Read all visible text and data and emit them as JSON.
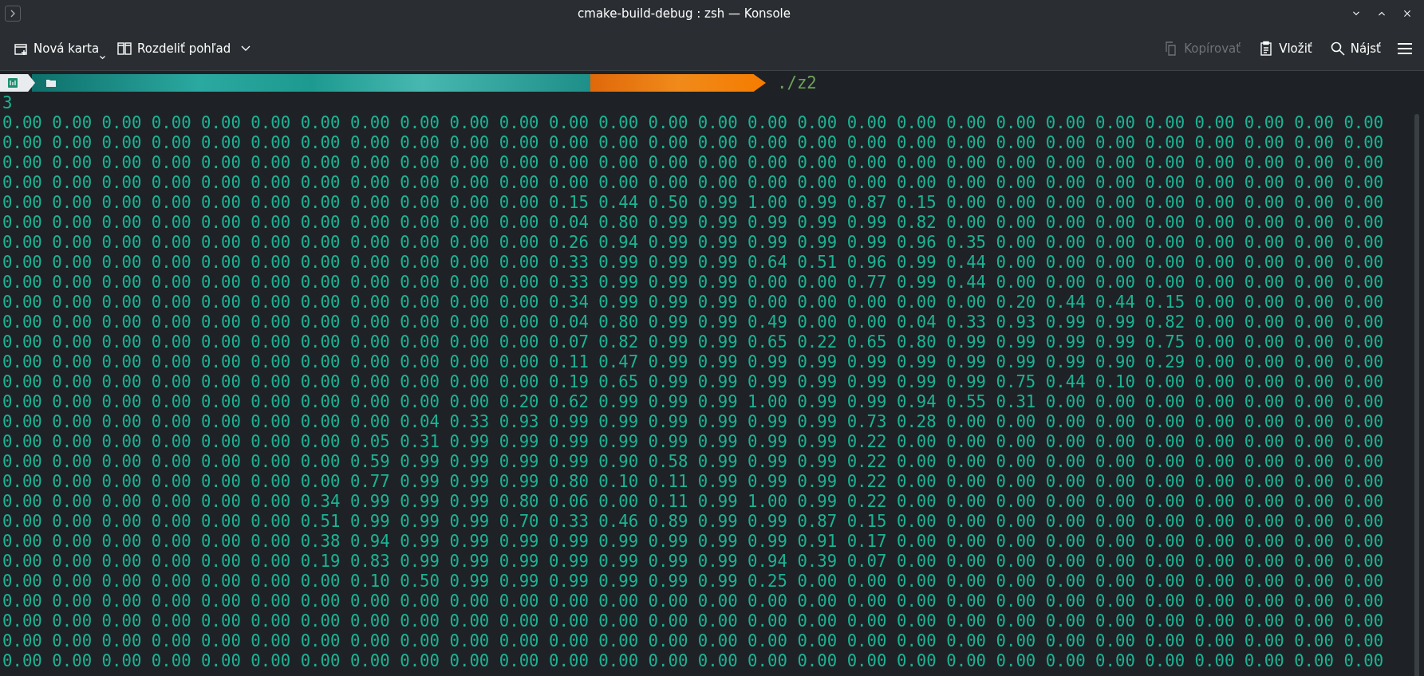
{
  "window": {
    "title": "cmake-build-debug : zsh — Konsole"
  },
  "toolbar": {
    "left": [
      {
        "label": "Nová karta",
        "kind": "menu"
      },
      {
        "label": "Rozdeliť pohľad",
        "kind": "dropdown"
      }
    ],
    "right": [
      {
        "label": "Kopírovať",
        "disabled": true
      },
      {
        "label": "Vložiť",
        "disabled": false
      },
      {
        "label": "Nájsť",
        "disabled": false
      }
    ]
  },
  "prompt": {
    "command": "./z2"
  },
  "output": {
    "lines": [
      "3",
      "0.00 0.00 0.00 0.00 0.00 0.00 0.00 0.00 0.00 0.00 0.00 0.00 0.00 0.00 0.00 0.00 0.00 0.00 0.00 0.00 0.00 0.00 0.00 0.00 0.00 0.00 0.00 0.00",
      "0.00 0.00 0.00 0.00 0.00 0.00 0.00 0.00 0.00 0.00 0.00 0.00 0.00 0.00 0.00 0.00 0.00 0.00 0.00 0.00 0.00 0.00 0.00 0.00 0.00 0.00 0.00 0.00",
      "0.00 0.00 0.00 0.00 0.00 0.00 0.00 0.00 0.00 0.00 0.00 0.00 0.00 0.00 0.00 0.00 0.00 0.00 0.00 0.00 0.00 0.00 0.00 0.00 0.00 0.00 0.00 0.00",
      "0.00 0.00 0.00 0.00 0.00 0.00 0.00 0.00 0.00 0.00 0.00 0.00 0.00 0.00 0.00 0.00 0.00 0.00 0.00 0.00 0.00 0.00 0.00 0.00 0.00 0.00 0.00 0.00",
      "0.00 0.00 0.00 0.00 0.00 0.00 0.00 0.00 0.00 0.00 0.00 0.15 0.44 0.50 0.99 1.00 0.99 0.87 0.15 0.00 0.00 0.00 0.00 0.00 0.00 0.00 0.00 0.00",
      "0.00 0.00 0.00 0.00 0.00 0.00 0.00 0.00 0.00 0.00 0.00 0.04 0.80 0.99 0.99 0.99 0.99 0.99 0.82 0.00 0.00 0.00 0.00 0.00 0.00 0.00 0.00 0.00",
      "0.00 0.00 0.00 0.00 0.00 0.00 0.00 0.00 0.00 0.00 0.00 0.26 0.94 0.99 0.99 0.99 0.99 0.99 0.96 0.35 0.00 0.00 0.00 0.00 0.00 0.00 0.00 0.00",
      "0.00 0.00 0.00 0.00 0.00 0.00 0.00 0.00 0.00 0.00 0.00 0.33 0.99 0.99 0.99 0.64 0.51 0.96 0.99 0.44 0.00 0.00 0.00 0.00 0.00 0.00 0.00 0.00",
      "0.00 0.00 0.00 0.00 0.00 0.00 0.00 0.00 0.00 0.00 0.00 0.33 0.99 0.99 0.99 0.00 0.00 0.77 0.99 0.44 0.00 0.00 0.00 0.00 0.00 0.00 0.00 0.00",
      "0.00 0.00 0.00 0.00 0.00 0.00 0.00 0.00 0.00 0.00 0.00 0.34 0.99 0.99 0.99 0.00 0.00 0.00 0.00 0.00 0.20 0.44 0.44 0.15 0.00 0.00 0.00 0.00",
      "0.00 0.00 0.00 0.00 0.00 0.00 0.00 0.00 0.00 0.00 0.00 0.04 0.80 0.99 0.99 0.49 0.00 0.00 0.04 0.33 0.93 0.99 0.99 0.82 0.00 0.00 0.00 0.00",
      "0.00 0.00 0.00 0.00 0.00 0.00 0.00 0.00 0.00 0.00 0.00 0.07 0.82 0.99 0.99 0.65 0.22 0.65 0.80 0.99 0.99 0.99 0.99 0.75 0.00 0.00 0.00 0.00",
      "0.00 0.00 0.00 0.00 0.00 0.00 0.00 0.00 0.00 0.00 0.00 0.11 0.47 0.99 0.99 0.99 0.99 0.99 0.99 0.99 0.99 0.99 0.90 0.29 0.00 0.00 0.00 0.00",
      "0.00 0.00 0.00 0.00 0.00 0.00 0.00 0.00 0.00 0.00 0.00 0.19 0.65 0.99 0.99 0.99 0.99 0.99 0.99 0.99 0.75 0.44 0.10 0.00 0.00 0.00 0.00 0.00",
      "0.00 0.00 0.00 0.00 0.00 0.00 0.00 0.00 0.00 0.00 0.20 0.62 0.99 0.99 0.99 1.00 0.99 0.99 0.94 0.55 0.31 0.00 0.00 0.00 0.00 0.00 0.00 0.00",
      "0.00 0.00 0.00 0.00 0.00 0.00 0.00 0.00 0.04 0.33 0.93 0.99 0.99 0.99 0.99 0.99 0.99 0.73 0.28 0.00 0.00 0.00 0.00 0.00 0.00 0.00 0.00 0.00",
      "0.00 0.00 0.00 0.00 0.00 0.00 0.00 0.05 0.31 0.99 0.99 0.99 0.99 0.99 0.99 0.99 0.99 0.22 0.00 0.00 0.00 0.00 0.00 0.00 0.00 0.00 0.00 0.00",
      "0.00 0.00 0.00 0.00 0.00 0.00 0.00 0.59 0.99 0.99 0.99 0.99 0.90 0.58 0.99 0.99 0.99 0.22 0.00 0.00 0.00 0.00 0.00 0.00 0.00 0.00 0.00 0.00",
      "0.00 0.00 0.00 0.00 0.00 0.00 0.00 0.77 0.99 0.99 0.99 0.80 0.10 0.11 0.99 0.99 0.99 0.22 0.00 0.00 0.00 0.00 0.00 0.00 0.00 0.00 0.00 0.00",
      "0.00 0.00 0.00 0.00 0.00 0.00 0.34 0.99 0.99 0.99 0.80 0.06 0.00 0.11 0.99 1.00 0.99 0.22 0.00 0.00 0.00 0.00 0.00 0.00 0.00 0.00 0.00 0.00",
      "0.00 0.00 0.00 0.00 0.00 0.00 0.51 0.99 0.99 0.99 0.70 0.33 0.46 0.89 0.99 0.99 0.87 0.15 0.00 0.00 0.00 0.00 0.00 0.00 0.00 0.00 0.00 0.00",
      "0.00 0.00 0.00 0.00 0.00 0.00 0.38 0.94 0.99 0.99 0.99 0.99 0.99 0.99 0.99 0.99 0.91 0.17 0.00 0.00 0.00 0.00 0.00 0.00 0.00 0.00 0.00 0.00",
      "0.00 0.00 0.00 0.00 0.00 0.00 0.19 0.83 0.99 0.99 0.99 0.99 0.99 0.99 0.99 0.94 0.39 0.07 0.00 0.00 0.00 0.00 0.00 0.00 0.00 0.00 0.00 0.00",
      "0.00 0.00 0.00 0.00 0.00 0.00 0.00 0.10 0.50 0.99 0.99 0.99 0.99 0.99 0.99 0.25 0.00 0.00 0.00 0.00 0.00 0.00 0.00 0.00 0.00 0.00 0.00 0.00",
      "0.00 0.00 0.00 0.00 0.00 0.00 0.00 0.00 0.00 0.00 0.00 0.00 0.00 0.00 0.00 0.00 0.00 0.00 0.00 0.00 0.00 0.00 0.00 0.00 0.00 0.00 0.00 0.00",
      "0.00 0.00 0.00 0.00 0.00 0.00 0.00 0.00 0.00 0.00 0.00 0.00 0.00 0.00 0.00 0.00 0.00 0.00 0.00 0.00 0.00 0.00 0.00 0.00 0.00 0.00 0.00 0.00",
      "0.00 0.00 0.00 0.00 0.00 0.00 0.00 0.00 0.00 0.00 0.00 0.00 0.00 0.00 0.00 0.00 0.00 0.00 0.00 0.00 0.00 0.00 0.00 0.00 0.00 0.00 0.00 0.00",
      "0.00 0.00 0.00 0.00 0.00 0.00 0.00 0.00 0.00 0.00 0.00 0.00 0.00 0.00 0.00 0.00 0.00 0.00 0.00 0.00 0.00 0.00 0.00 0.00 0.00 0.00 0.00 0.00"
    ]
  }
}
